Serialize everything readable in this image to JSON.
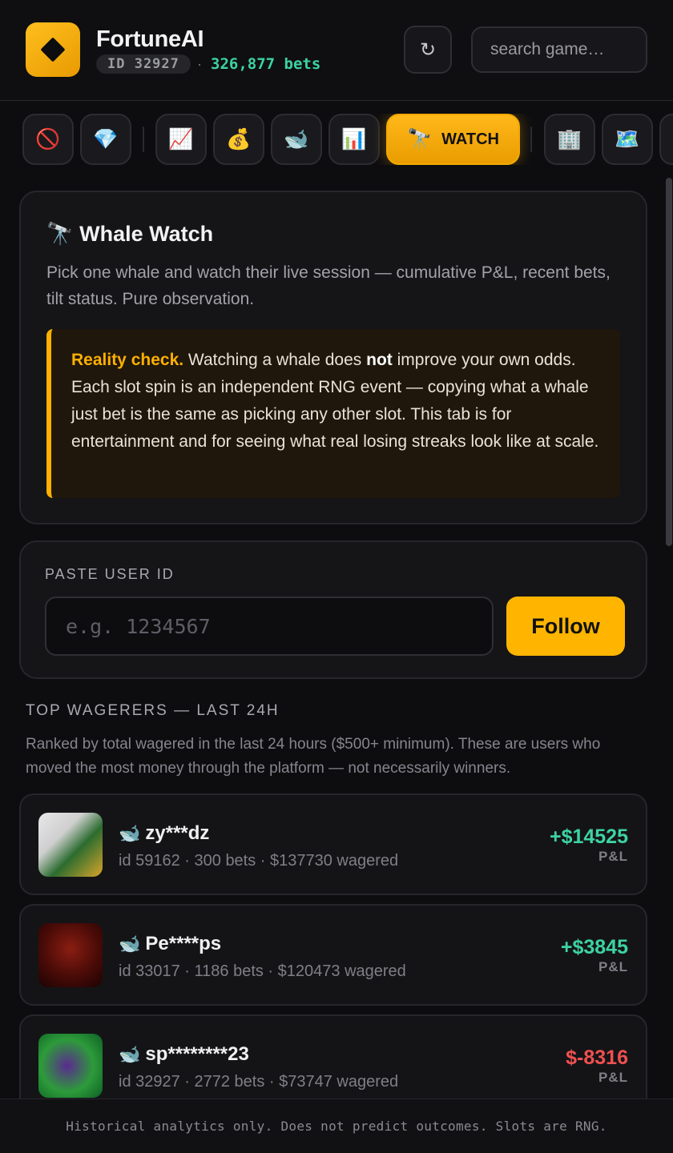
{
  "header": {
    "brand": "FortuneAI",
    "user_id": "ID 32927",
    "separator": "·",
    "bets": "326,877 bets",
    "refresh_icon": "↻",
    "search_placeholder": "search game…"
  },
  "tabs": [
    {
      "icon": "🚫",
      "name": "blocked"
    },
    {
      "icon": "💎",
      "name": "gems"
    },
    {
      "icon": "📈",
      "name": "trends"
    },
    {
      "icon": "💰",
      "name": "money"
    },
    {
      "icon": "🐋",
      "name": "whales"
    },
    {
      "icon": "📊",
      "name": "stats"
    },
    {
      "icon": "🔭",
      "label": "WATCH",
      "name": "watch",
      "active": true
    },
    {
      "icon": "🏢",
      "name": "providers"
    },
    {
      "icon": "🗺️",
      "name": "map"
    }
  ],
  "intro": {
    "title_icon": "🔭",
    "title": "Whale Watch",
    "description": "Pick one whale and watch their live session — cumulative P&L, recent bets, tilt status. Pure observation.",
    "reality_lead": "Reality check.",
    "reality_part1": " Watching a whale does ",
    "reality_bold": "not",
    "reality_part2": " improve your own odds. Each slot spin is an independent RNG event — copying what a whale just bet is the same as picking any other slot. This tab is for entertainment and for seeing what real losing streaks look like at scale."
  },
  "paste": {
    "label": "PASTE USER ID",
    "placeholder": "e.g. 1234567",
    "button": "Follow"
  },
  "wagerers": {
    "heading": "TOP WAGERERS — LAST 24H",
    "description": "Ranked by total wagered in the last 24 hours ($500+ minimum). These are users who moved the most money through the platform — not necessarily winners.",
    "pl_label": "P&L",
    "whale_icon": "🐋",
    "rows": [
      {
        "name": "zy***dz",
        "meta": "id 59162 · 300 bets · $137730 wagered",
        "pl": "+$14525",
        "positive": true
      },
      {
        "name": "Pe****ps",
        "meta": "id 33017 · 1186 bets · $120473 wagered",
        "pl": "+$3845",
        "positive": true
      },
      {
        "name": "sp********23",
        "meta": "id 32927 · 2772 bets · $73747 wagered",
        "pl": "$-8316",
        "positive": false
      }
    ]
  },
  "footer": "Historical analytics only. Does not predict outcomes. Slots are RNG.",
  "colors": {
    "accent": "#ffb400",
    "positive": "#3dd3a0",
    "negative": "#f05050",
    "background": "#0d0d10"
  }
}
